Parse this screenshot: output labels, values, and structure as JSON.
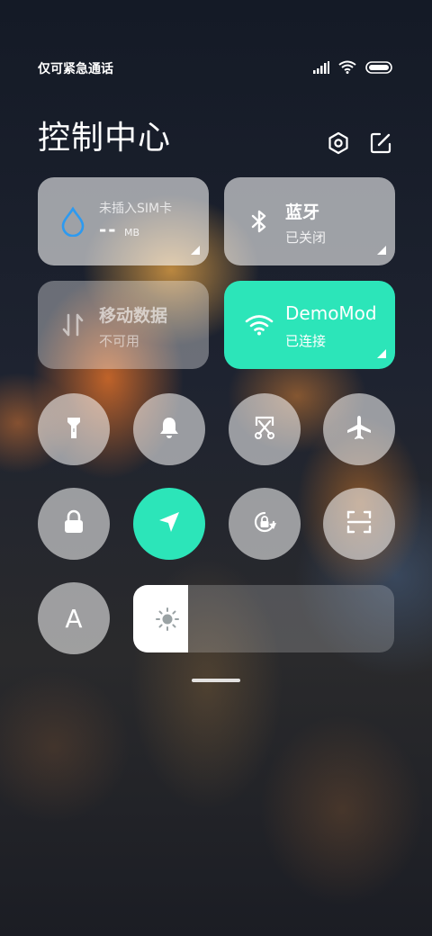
{
  "status_bar": {
    "carrier": "仅可紧急通话",
    "icons": [
      "signal-icon",
      "wifi-icon",
      "battery-icon"
    ]
  },
  "header": {
    "title": "控制中心",
    "icons": [
      "settings-icon",
      "edit-icon"
    ]
  },
  "cards": {
    "sim": {
      "line1": "未插入SIM卡",
      "value": "--",
      "unit": "MB",
      "icon": "drop-icon"
    },
    "bluetooth": {
      "label": "蓝牙",
      "status": "已关闭",
      "icon": "bluetooth-icon"
    },
    "mobile_data": {
      "label": "移动数据",
      "status": "不可用",
      "icon": "data-arrows-icon"
    },
    "wifi": {
      "label": "DemoMode",
      "status": "已连接",
      "icon": "wifi-icon"
    }
  },
  "toggles": {
    "flashlight": {
      "icon": "flashlight-icon",
      "active": false
    },
    "bell": {
      "icon": "bell-icon",
      "active": false
    },
    "screenshot": {
      "icon": "scissors-icon",
      "active": false
    },
    "airplane": {
      "icon": "airplane-icon",
      "active": false
    },
    "lock": {
      "icon": "lock-icon",
      "active": false
    },
    "location": {
      "icon": "location-icon",
      "active": true
    },
    "rotation": {
      "icon": "rotation-lock-icon",
      "active": false
    },
    "scanner": {
      "icon": "scanner-icon",
      "active": false
    },
    "font": {
      "label": "A",
      "icon": "font-icon",
      "active": false
    }
  },
  "brightness": {
    "icon": "sun-icon",
    "level": 0.21
  },
  "colors": {
    "accent": "#2ce5b9",
    "drop_blue": "#2d9af0"
  }
}
